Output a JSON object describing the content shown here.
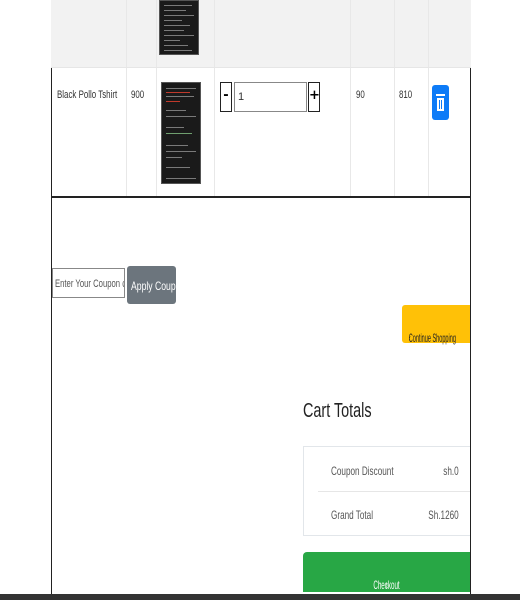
{
  "cart": {
    "rows": [
      {
        "name": "",
        "price": "",
        "quantity": "",
        "total": ""
      },
      {
        "name": "Black Pollo Tshirt",
        "price": "900",
        "quantity": "1",
        "unit_value": "90",
        "total": "810"
      }
    ],
    "qty_minus": "-",
    "qty_plus": "+"
  },
  "coupon": {
    "placeholder": "Enter Your Coupon code",
    "apply_label": "Apply Coupon"
  },
  "continue_shopping": {
    "label": "Continue Shopping"
  },
  "cart_totals": {
    "title": "Cart Totals",
    "coupon_discount_label": "Coupon Discount",
    "coupon_discount_value": "sh.0",
    "grand_total_label": "Grand Total",
    "grand_total_value": "Sh.1260"
  },
  "checkout": {
    "label": "Checkout"
  },
  "colors": {
    "primary": "#0d7bf7",
    "secondary": "#6c757d",
    "warning": "#ffc107",
    "success": "#28a745"
  }
}
